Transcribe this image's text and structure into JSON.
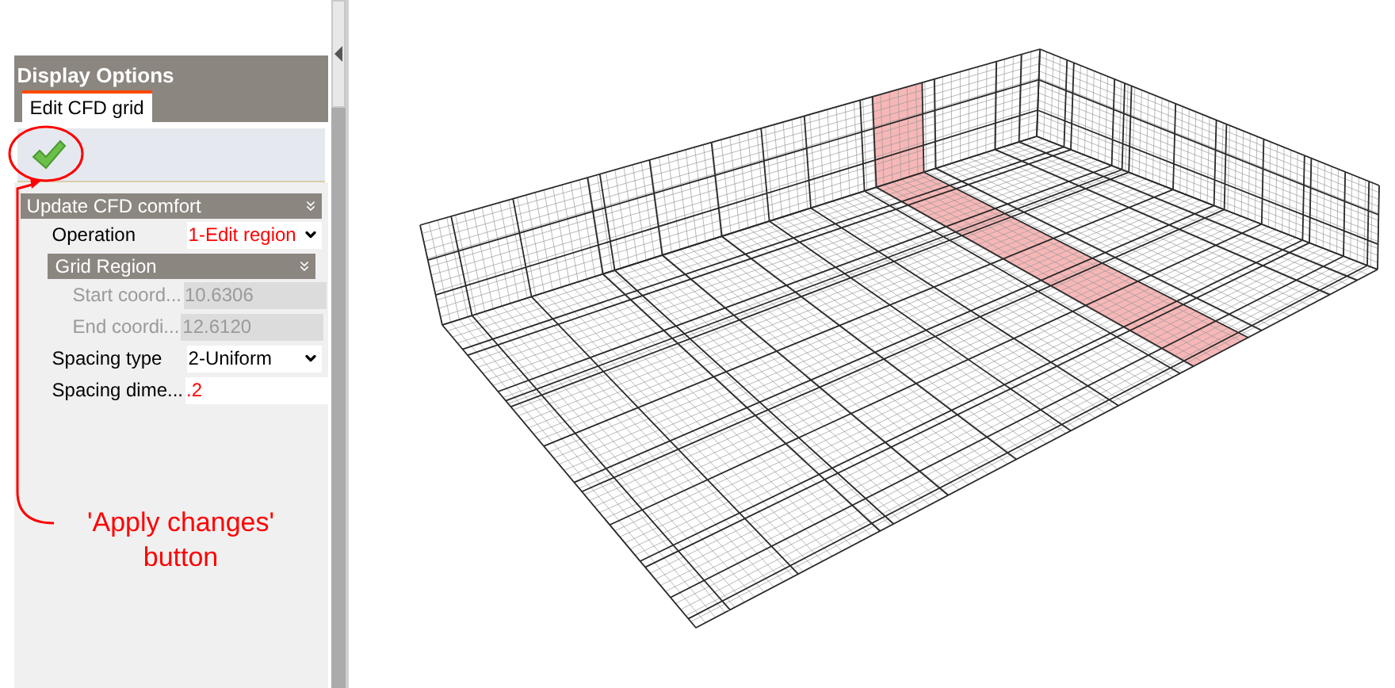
{
  "panel": {
    "title": "Display Options"
  },
  "tabs": [
    {
      "label": "Edit CFD grid",
      "selected": true
    }
  ],
  "section": {
    "title": "Update CFD comfort",
    "expanded": true
  },
  "properties": [
    {
      "kind": "dropdown",
      "label": "Operation",
      "value": "1-Edit region",
      "modified": true
    },
    {
      "kind": "group",
      "label": "Grid Region",
      "expanded": true
    },
    {
      "kind": "field",
      "label": "Start coord...",
      "value": "10.6306",
      "disabled": true
    },
    {
      "kind": "field",
      "label": "End coordi...",
      "value": "12.6120",
      "disabled": true
    },
    {
      "kind": "dropdown",
      "label": "Spacing type",
      "value": "2-Uniform",
      "modified": false
    },
    {
      "kind": "field",
      "label": "Spacing dime...",
      "value": ".2",
      "disabled": false,
      "modified": true
    }
  ],
  "annotation": {
    "text": "'Apply changes' button"
  }
}
